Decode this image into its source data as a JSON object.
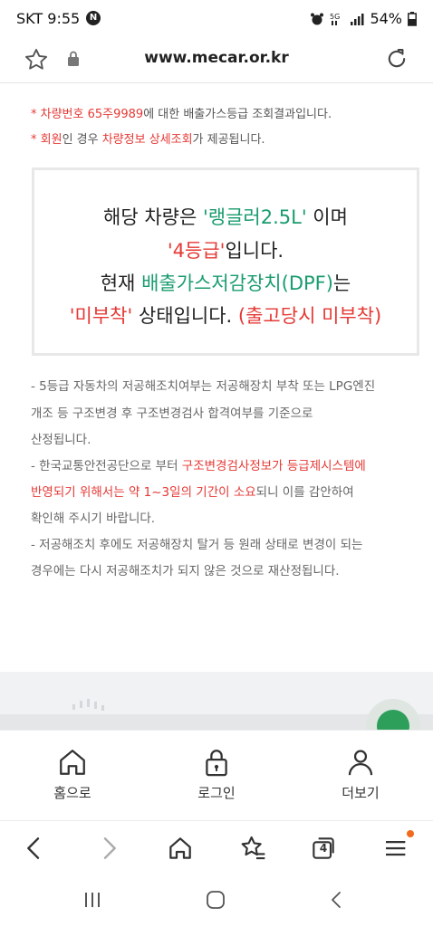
{
  "status": {
    "carrier_time": "SKT 9:55",
    "notification_badge": "N",
    "battery": "54%"
  },
  "address": {
    "url": "www.mecar.or.kr"
  },
  "notes": {
    "line1": {
      "prefix": "* ",
      "highlight": "차량번호 65주9989",
      "rest": "에 대한 배출가스등급 조회결과입니다."
    },
    "line2": {
      "prefix": "* ",
      "h1": "회원",
      "mid": "인 경우 ",
      "h2": "차량정보 상세조회",
      "rest": "가 제공됩니다."
    }
  },
  "result": {
    "l1_a": "해당 차량은 ",
    "l1_model": "'랭글러2.5L'",
    "l1_b": " 이며",
    "l2_grade": "'4등급'",
    "l2_b": "입니다.",
    "l3_a": "현재 ",
    "l3_dpf": "배출가스저감장치(DPF)",
    "l3_b": "는",
    "l4_state": "'미부착'",
    "l4_b": " 상태입니다. ",
    "l4_note": "(출고당시 미부착)"
  },
  "bullets": {
    "b1": [
      "- 5등급 자동차의 저공해조치여부는 저공해장치 부착 또는 LPG엔진",
      "개조 등 구조변경 후 구조변경검사 합격여부를 기준으로",
      "산정됩니다."
    ],
    "b2_l1_a": "- 한국교통안전공단으로 부터 ",
    "b2_l1_red": "구조변경검사정보가 등급제시스템에",
    "b2_l2_red": "반영되기 위해서는 약 1~3일의 기간이 소요",
    "b2_l2_b": "되니 이를 감안하여",
    "b2_l3": "확인해 주시기 바랍니다.",
    "b3": [
      "- 저공해조치 후에도 저공해장치 탈거 등 원래 상태로 변경이 되는",
      "경우에는 다시 저공해조치가 되지 않은 것으로 재산정됩니다."
    ]
  },
  "app_nav": {
    "home": "홈으로",
    "login": "로그인",
    "more": "더보기"
  },
  "browser": {
    "tabs_count": "4"
  },
  "colors": {
    "red": "#e53935",
    "green": "#1a9c6d",
    "brand_green": "#2e9e5b"
  },
  "icons": [
    "star-icon",
    "lock-icon",
    "reload-icon",
    "home-icon",
    "padlock-icon",
    "person-icon",
    "back-arrow-icon",
    "forward-arrow-icon",
    "bookmark-star-icon",
    "tabs-icon",
    "menu-icon",
    "recents-icon",
    "home-button-icon",
    "back-button-icon"
  ]
}
